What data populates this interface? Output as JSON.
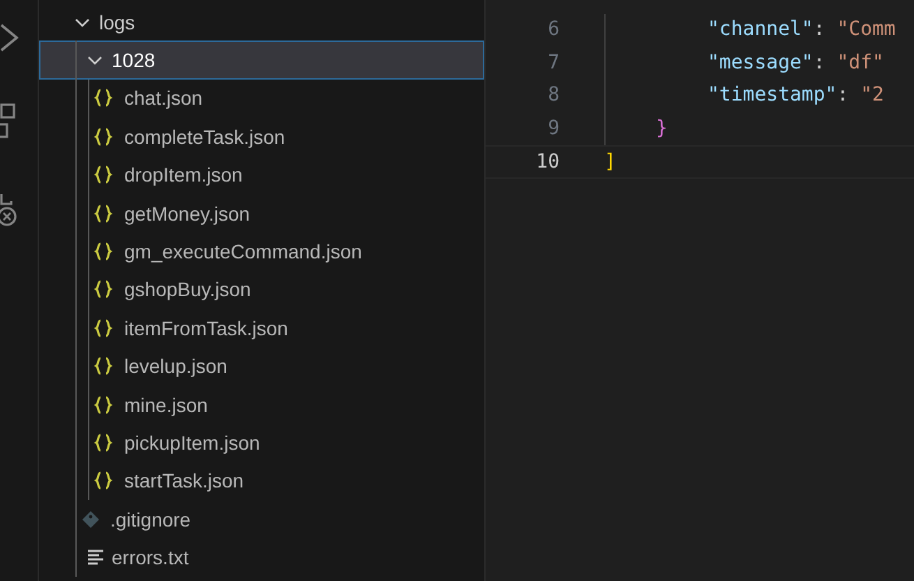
{
  "explorer": {
    "tree": [
      {
        "label": "logs",
        "kind": "folder",
        "expanded": true,
        "selected": false,
        "children": [
          {
            "label": "1028",
            "kind": "folder",
            "expanded": true,
            "selected": true,
            "children": [
              {
                "label": "chat.json",
                "kind": "json",
                "selected": false
              },
              {
                "label": "completeTask.json",
                "kind": "json",
                "selected": false
              },
              {
                "label": "dropItem.json",
                "kind": "json",
                "selected": false
              },
              {
                "label": "getMoney.json",
                "kind": "json",
                "selected": false
              },
              {
                "label": "gm_executeCommand.json",
                "kind": "json",
                "selected": false
              },
              {
                "label": "gshopBuy.json",
                "kind": "json",
                "selected": false
              },
              {
                "label": "itemFromTask.json",
                "kind": "json",
                "selected": false
              },
              {
                "label": "levelup.json",
                "kind": "json",
                "selected": false
              },
              {
                "label": "mine.json",
                "kind": "json",
                "selected": false
              },
              {
                "label": "pickupItem.json",
                "kind": "json",
                "selected": false
              },
              {
                "label": "startTask.json",
                "kind": "json",
                "selected": false
              }
            ]
          },
          {
            "label": ".gitignore",
            "kind": "git",
            "selected": false
          },
          {
            "label": "errors.txt",
            "kind": "text",
            "selected": false
          }
        ]
      }
    ]
  },
  "editor": {
    "lines": [
      {
        "children": [
          {
            "children": [
              {
                "number": "6",
                "current": false,
                "tokens": [
                  {
                    "kind": "key",
                    "text": "\"channel\""
                  },
                  {
                    "kind": "punct",
                    "text": ": "
                  },
                  {
                    "kind": "string",
                    "text": "\"Comm"
                  }
                ]
              },
              {
                "number": "7",
                "current": false,
                "tokens": [
                  {
                    "kind": "key",
                    "text": "\"message\""
                  },
                  {
                    "kind": "punct",
                    "text": ": "
                  },
                  {
                    "kind": "string",
                    "text": "\"df\""
                  }
                ]
              },
              {
                "number": "8",
                "current": false,
                "tokens": [
                  {
                    "kind": "key",
                    "text": "\"timestamp\""
                  },
                  {
                    "kind": "punct",
                    "text": ": "
                  },
                  {
                    "kind": "string",
                    "text": "\"2"
                  }
                ]
              }
            ]
          },
          {
            "number": "9",
            "current": false,
            "tokens": [
              {
                "kind": "brace",
                "text": "}"
              }
            ]
          }
        ]
      },
      {
        "number": "10",
        "current": true,
        "tokens": [
          {
            "kind": "bracket",
            "text": "]"
          }
        ]
      }
    ]
  }
}
